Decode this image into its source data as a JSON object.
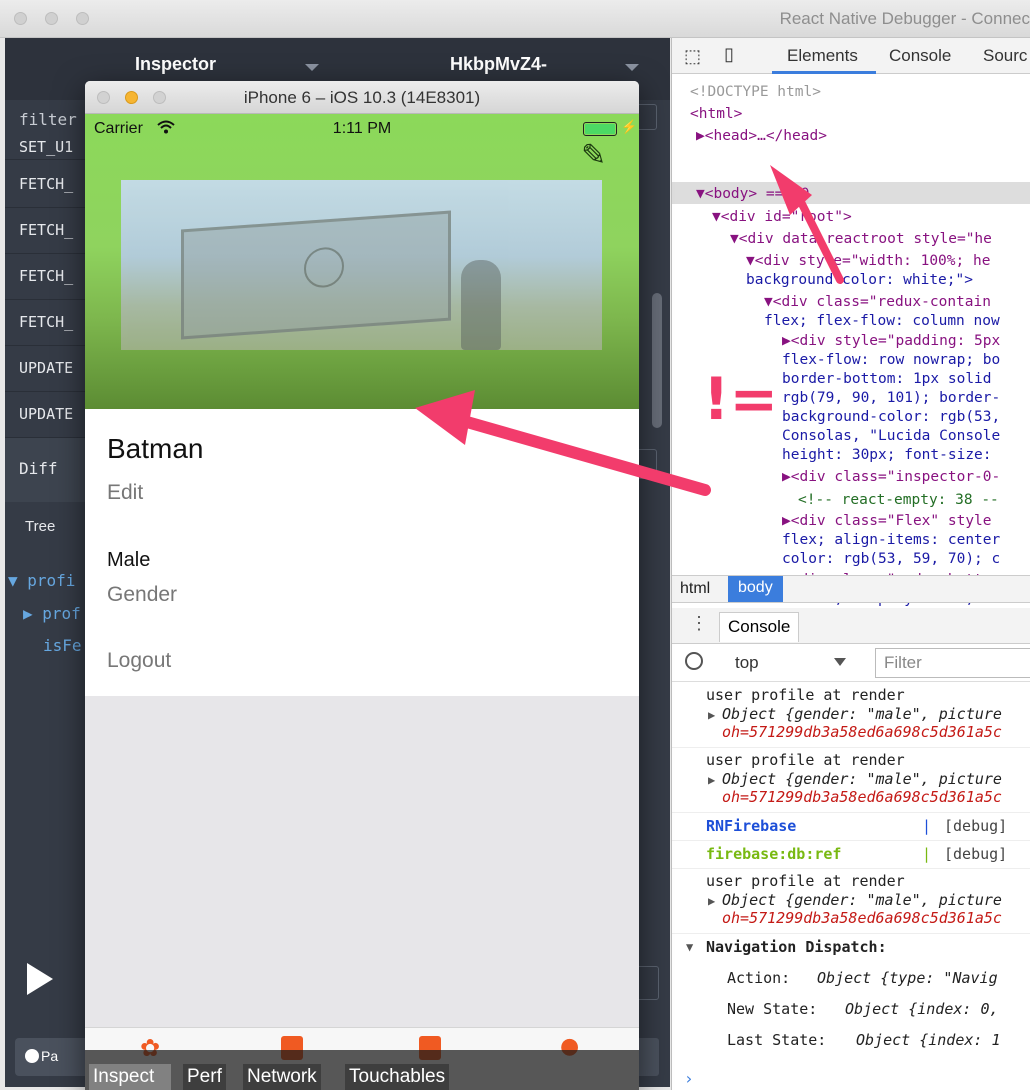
{
  "window": {
    "title": "React Native Debugger - Connec"
  },
  "redux_panel": {
    "header_left": "Inspector",
    "header_right": "HkbpMvZ4-",
    "filter_placeholder": "filter",
    "actions": [
      "SET_U1",
      "FETCH_",
      "FETCH_",
      "FETCH_",
      "FETCH_",
      "UPDATE",
      "UPDATE"
    ],
    "diff_label": "Diff",
    "tree_tab": "Tree",
    "tree_lines": [
      "▼ profi",
      "▶ prof",
      "isFe"
    ],
    "pause_label": "Pa"
  },
  "simulator": {
    "title": "iPhone 6 – iOS 10.3 (14E8301)",
    "carrier": "Carrier",
    "time": "1:11 PM",
    "name": "Batman",
    "edit": "Edit",
    "gender_value": "Male",
    "gender_label": "Gender",
    "logout": "Logout",
    "inspector_buttons": [
      "Inspect",
      "Perf",
      "Network",
      "Touchables"
    ]
  },
  "devtools": {
    "tabs": [
      "Elements",
      "Console",
      "Sourc"
    ],
    "elements_lines": [
      "<!DOCTYPE html>",
      "<html>",
      "▶<head>…</head>",
      "▼<body> == $0",
      "▼<div id=\"root\">",
      "▼<div data-reactroot style=\"he",
      "▼<div style=\"width: 100%; he",
      "background-color: white;\">",
      "▼<div class=\"redux-contain",
      "flex; flex-flow: column now",
      "▶<div style=\"padding: 5px",
      "flex-flow: row nowrap; bo",
      "border-bottom: 1px solid",
      "rgb(79, 90, 101); border-",
      "background-color: rgb(53,",
      "Consolas, \"Lucida Console",
      "height: 30px; font-size:",
      "▶<div class=\"inspector-0-",
      "<!-- react-empty: 38 --",
      "▶<div class=\"Flex\" style",
      "flex; align-items: center",
      "color: rgb(53, 59, 70); c",
      "▶<div class=\"redux-butto",
      "center; display: flex; fl"
    ],
    "breadcrumbs": [
      "html",
      "body"
    ],
    "console_tab": "Console",
    "context": "top",
    "filter_placeholder": "Filter",
    "messages": {
      "render1": "user profile at render",
      "obj1": "Object {gender: \"male\", picture",
      "url1": "oh=571299db3a58ed6a698c5d361a5c",
      "render2": "user profile at render",
      "obj2": "Object {gender: \"male\", picture",
      "url2": "oh=571299db3a58ed6a698c5d361a5c",
      "rnfb": "RNFirebase",
      "rnfb_level": "[debug]",
      "fbref": "firebase:db:ref",
      "fbref_level": "[debug]",
      "render3": "user profile at render",
      "obj3": "Object {gender: \"male\", picture",
      "url3": "oh=571299db3a58ed6a698c5d361a5c",
      "nav": "Navigation Dispatch:",
      "action_label": "Action:",
      "action_val": "Object {type: \"Navig",
      "new_label": "New State:",
      "new_val": "Object {index: 0,",
      "last_label": "Last State:",
      "last_val": "Object {index: 1"
    }
  },
  "annotation": {
    "text": "!="
  },
  "colors": {
    "accent": "#f23c6c",
    "devtools_blue": "#3b7ddd",
    "redux_bg": "#353b46"
  }
}
